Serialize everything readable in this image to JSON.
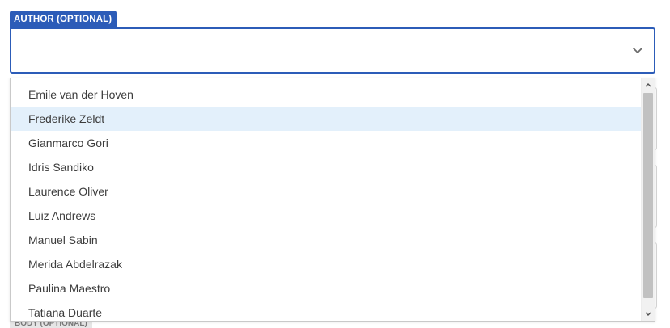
{
  "author_field": {
    "label": "AUTHOR (OPTIONAL)",
    "value": ""
  },
  "dropdown": {
    "options": [
      "Emile van der Hoven",
      "Frederike Zeldt",
      "Gianmarco Gori",
      "Idris Sandiko",
      "Laurence Oliver",
      "Luiz Andrews",
      "Manuel Sabin",
      "Merida Abdelrazak",
      "Paulina Maestro",
      "Tatiana Duarte"
    ],
    "highlighted_index": 1
  },
  "body_field": {
    "label": "BODY (OPTIONAL)"
  },
  "icons": {
    "select_chevron": "chevron-down-icon",
    "scroll_up": "scroll-up-arrow-icon",
    "scroll_down": "scroll-down-arrow-icon"
  },
  "colors": {
    "accent": "#2c5cb8",
    "highlight": "#e3f0fb",
    "label_text": "#ffffff"
  }
}
